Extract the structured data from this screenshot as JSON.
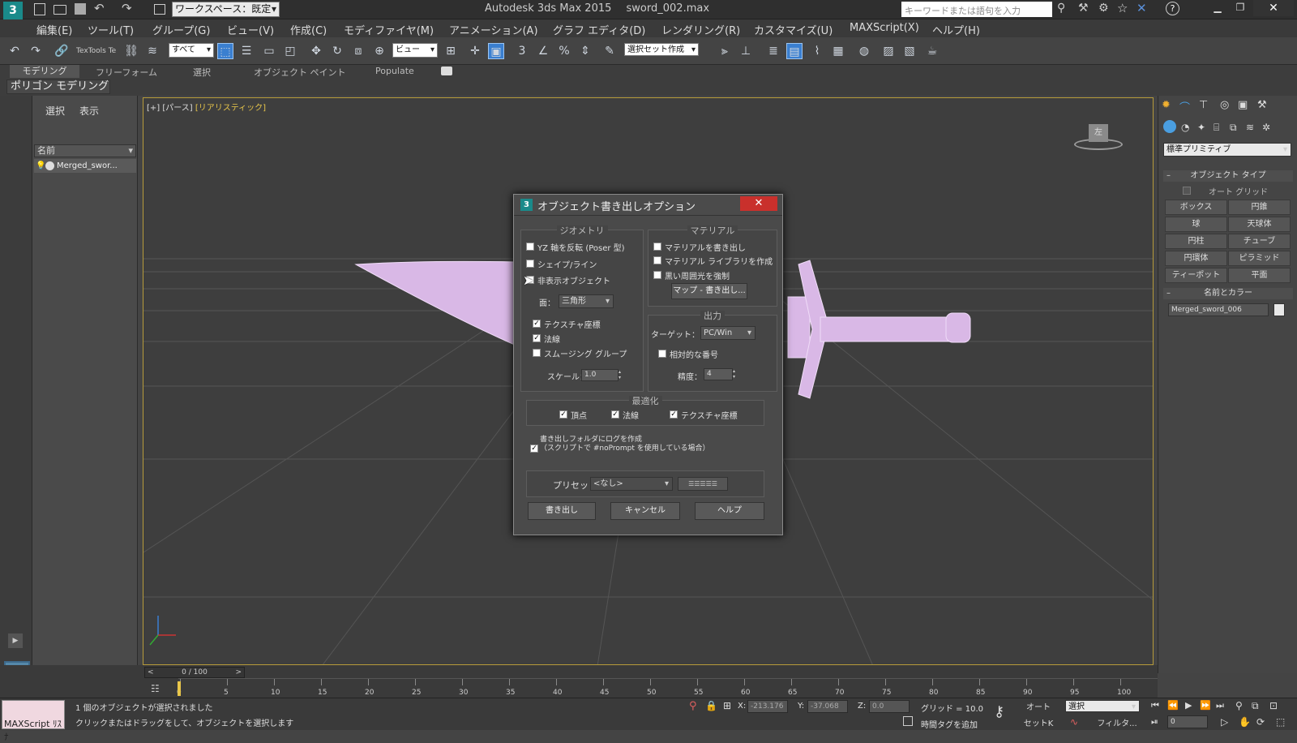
{
  "title": {
    "workspace": "ワークスペース：既定",
    "app": "Autodesk 3ds Max  2015",
    "file": "sword_002.max",
    "search_placeholder": "キーワードまたは語句を入力"
  },
  "menus": [
    "編集(E)",
    "ツール(T)",
    "グループ(G)",
    "ビュー(V)",
    "作成(C)",
    "モディファイヤ(M)",
    "アニメーション(A)",
    "グラフ エディタ(D)",
    "レンダリング(R)",
    "カスタマイズ(U)",
    "MAXScript(X)",
    "ヘルプ(H)"
  ],
  "toolbar": {
    "filter": "すべて",
    "textools": "TexTools Te",
    "refcoord": "ビュー",
    "selset": "選択セット作成"
  },
  "ribbon": {
    "tabs": [
      "モデリング",
      "フリーフォーム",
      "選択",
      "オブジェクト ペイント",
      "Populate"
    ],
    "sub": "ポリゴン モデリング"
  },
  "scene": {
    "tabs": [
      "選択",
      "表示"
    ],
    "column": "名前",
    "item": "Merged_swor..."
  },
  "viewport": {
    "label_plus": "[+]",
    "label_view": "[パース]",
    "label_shade": "[リアリスティック]",
    "viewcube": "左"
  },
  "cmdpanel": {
    "category": "標準プリミティブ",
    "rollout_type": "オブジェクト タイプ",
    "autogrid": "オート グリッド",
    "buttons": [
      "ボックス",
      "円錐",
      "球",
      "天球体",
      "円柱",
      "チューブ",
      "円環体",
      "ピラミッド",
      "ティーポット",
      "平面"
    ],
    "rollout_name": "名前とカラー",
    "object_name": "Merged_sword_006"
  },
  "dialog": {
    "title": "オブジェクト書き出しオプション",
    "geometry": {
      "title": "ジオメトリ",
      "flip_yz": "YZ 軸を反転 (Poser 型)",
      "shapes": "シェイプ/ライン",
      "hidden": "非表示オブジェクト",
      "faces_label": "面：",
      "faces_value": "三角形",
      "texcoords": "テクスチャ座標",
      "normals": "法線",
      "smoothing": "スムージング グループ",
      "scale_label": "スケール：",
      "scale_value": "1.0"
    },
    "material": {
      "title": "マテリアル",
      "export": "マテリアルを書き出し",
      "create_lib": "マテリアル ライブラリを作成",
      "force_black": "黒い周囲光を強制",
      "map_export": "マップ - 書き出し..."
    },
    "output": {
      "title": "出力",
      "target_label": "ターゲット：",
      "target_value": "PC/Win",
      "relative": "相対的な番号",
      "precision_label": "精度：",
      "precision_value": "4"
    },
    "optimize": {
      "title": "最適化",
      "vertex": "頂点",
      "normals": "法線",
      "texcoords": "テクスチャ座標"
    },
    "log_line1": "書き出しフォルダにログを作成",
    "log_line2": "（スクリプトで #noPrompt を使用している場合）",
    "preset_label": "プリセット：",
    "preset_value": "<なし>",
    "buttons": {
      "export": "書き出し",
      "cancel": "キャンセル",
      "help": "ヘルプ"
    }
  },
  "timeline": {
    "frame": "0 / 100",
    "ticks": [
      "0",
      "5",
      "10",
      "15",
      "20",
      "25",
      "30",
      "35",
      "40",
      "45",
      "50",
      "55",
      "60",
      "65",
      "70",
      "75",
      "80",
      "85",
      "90",
      "95",
      "100"
    ]
  },
  "status": {
    "maxscript": "MAXScript ﾘｽﾅ",
    "line1": "1 個のオブジェクトが選択されました",
    "line2": "クリックまたはドラッグをして、オブジェクトを選択します",
    "x_label": "X:",
    "x_value": "-213.176",
    "y_label": "Y:",
    "y_value": "-37.068",
    "z_label": "Z:",
    "z_value": "0.0",
    "grid": "グリッド = 10.0",
    "add_tag": "時間タグを追加",
    "auto": "オート",
    "setkey": "セットK",
    "selection": "選択",
    "filters": "フィルタ...",
    "frame_field": "0"
  },
  "colors": {
    "accent": "#b69b3a",
    "mesh": "#d9b8e6",
    "selection_highlight": "#3a7fd0"
  }
}
